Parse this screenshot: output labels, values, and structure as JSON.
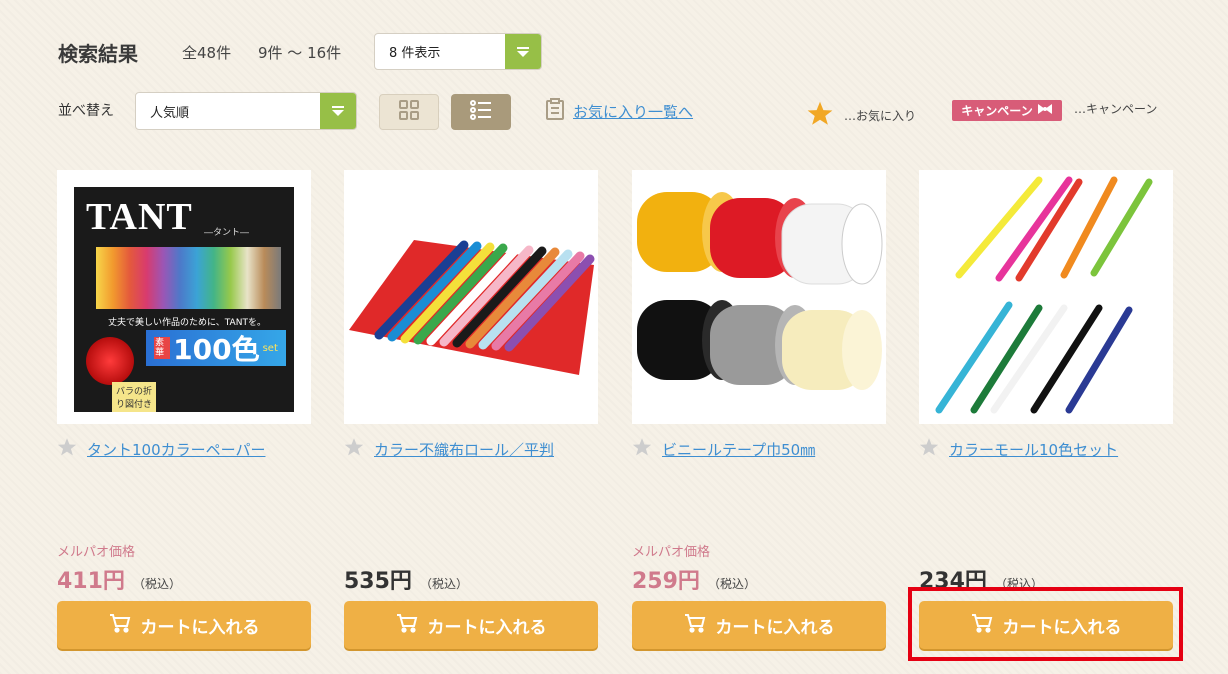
{
  "header": {
    "title": "検索結果",
    "total": "全48件",
    "range": "9件 ～ 16件",
    "per_page_select": {
      "value": "8 件表示"
    }
  },
  "controls": {
    "sort_label": "並べ替え",
    "sort_select": {
      "value": "人気順"
    },
    "favorites_link": "お気に入り一覧へ",
    "legend_favorite": "…お気に入り",
    "campaign_tag": "キャンペーン",
    "legend_campaign": "…キャンペーン"
  },
  "products": [
    {
      "name": "タント100カラーペーパー",
      "price_label": "メルパオ価格",
      "price": "411円",
      "tax": "（税込）",
      "cart": "カートに入れる",
      "image": {
        "brand": "TANT",
        "sub": "―タント―",
        "big": "100色",
        "small1": "素華",
        "small2": "set",
        "note": "バラの折り図付き",
        "headline": "丈夫で美しい作品のために、TANTを。"
      }
    },
    {
      "name": "カラー不織布ロール／平判",
      "price_label": "",
      "price": "535円",
      "tax": "（税込）",
      "cart": "カートに入れる"
    },
    {
      "name": "ビニールテープ巾50㎜",
      "price_label": "メルパオ価格",
      "price": "259円",
      "tax": "（税込）",
      "cart": "カートに入れる"
    },
    {
      "name": "カラーモール10色セット",
      "price_label": "",
      "price": "234円",
      "tax": "（税込）",
      "cart": "カートに入れる"
    }
  ],
  "colors": {
    "accent_green": "#97bf47",
    "cart_orange": "#efb045",
    "link_blue": "#3e8ed1",
    "price_pink": "#d07a8c",
    "highlight_red": "#e50012"
  }
}
